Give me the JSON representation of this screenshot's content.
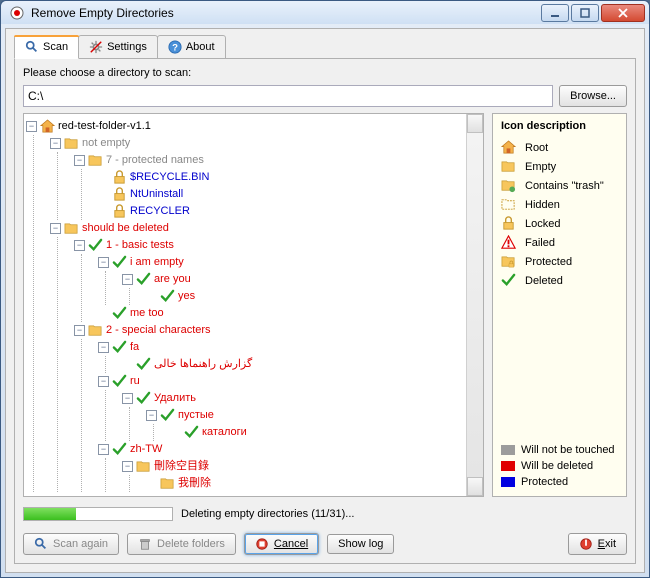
{
  "window": {
    "title": "Remove Empty Directories"
  },
  "tabs": {
    "scan": "Scan",
    "settings": "Settings",
    "about": "About"
  },
  "dir": {
    "label": "Please choose a directory to scan:",
    "value": "C:\\",
    "browse": "Browse..."
  },
  "tree": {
    "root": "red-test-folder-v1.1",
    "not_empty": "not empty",
    "protected": "7 - protected names",
    "recycle": "$RECYCLE.BIN",
    "ntuninstall": "NtUninstall",
    "recycler": "RECYCLER",
    "should_be_deleted": "should be deleted",
    "basic": "1 - basic tests",
    "iamempty": "i am empty",
    "areyou": "are you",
    "yes": "yes",
    "metoo": "me too",
    "special": "2 - special characters",
    "fa": "fa",
    "fa_child": "گزارش راهنماها خالی",
    "ru": "ru",
    "ru_del": "Удалить",
    "ru_empty": "пустые",
    "ru_cat": "каталоги",
    "zhtw": "zh-TW",
    "zh1": "刪除空目錄",
    "zh2": "我刪除"
  },
  "legend": {
    "title": "Icon description",
    "root": "Root",
    "empty": "Empty",
    "trash": "Contains \"trash\"",
    "hidden": "Hidden",
    "locked": "Locked",
    "failed": "Failed",
    "protected": "Protected",
    "deleted": "Deleted",
    "grey": "Will not be touched",
    "red": "Will be deleted",
    "blue": "Protected"
  },
  "progress": {
    "value": 35,
    "text": "Deleting empty directories (11/31)..."
  },
  "buttons": {
    "scan_again": "Scan again",
    "delete": "Delete folders",
    "cancel": "Cancel",
    "showlog": "Show log",
    "exit": "Exit"
  },
  "colors": {
    "grey": "#9c9c9c",
    "red": "#e00000",
    "blue": "#0000e0"
  }
}
